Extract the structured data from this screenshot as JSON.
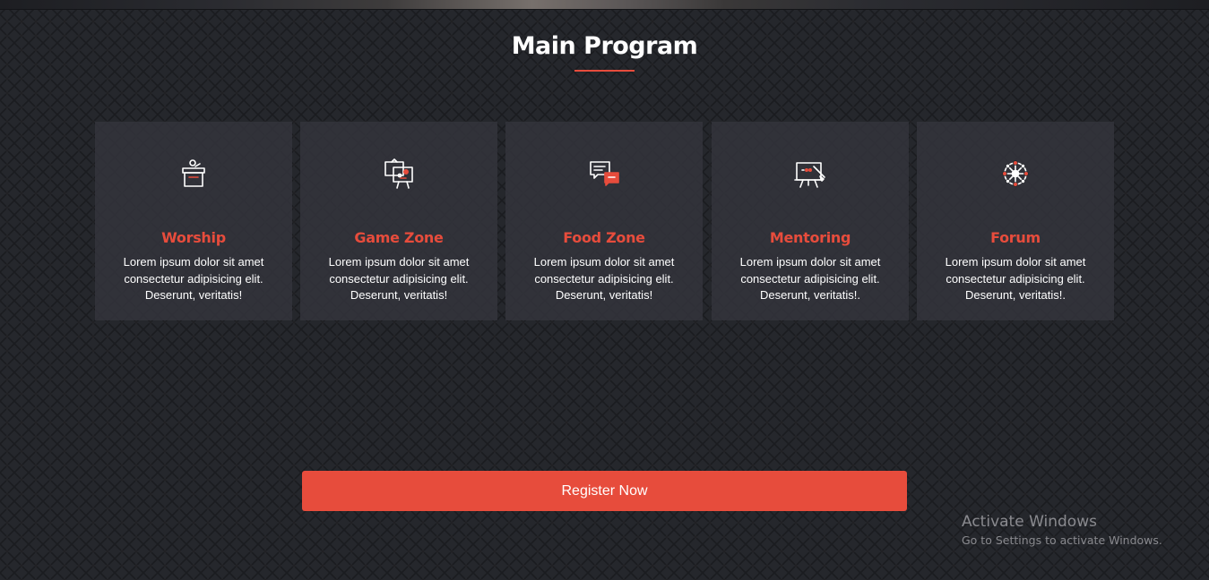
{
  "section": {
    "title": "Main Program"
  },
  "colors": {
    "accent": "#e74c3c",
    "background": "#25272c",
    "card": "#34363d"
  },
  "cards": [
    {
      "icon": "podium-icon",
      "title": "Worship",
      "text": "Lorem ipsum dolor sit amet consectetur adipisicing elit. Deserunt, veritatis!"
    },
    {
      "icon": "presentation-easel-icon",
      "title": "Game Zone",
      "text": "Lorem ipsum dolor sit amet consectetur adipisicing elit. Deserunt, veritatis!"
    },
    {
      "icon": "chat-bubbles-icon",
      "title": "Food Zone",
      "text": "Lorem ipsum dolor sit amet consectetur adipisicing elit. Deserunt, veritatis!"
    },
    {
      "icon": "whiteboard-icon",
      "title": "Mentoring",
      "text": "Lorem ipsum dolor sit amet consectetur adipisicing elit. Deserunt, veritatis!."
    },
    {
      "icon": "network-wheel-icon",
      "title": "Forum",
      "text": "Lorem ipsum dolor sit amet consectetur adipisicing elit. Deserunt, veritatis!."
    }
  ],
  "register": {
    "label": "Register Now"
  },
  "watermark": {
    "title": "Activate Windows",
    "subtitle": "Go to Settings to activate Windows."
  }
}
